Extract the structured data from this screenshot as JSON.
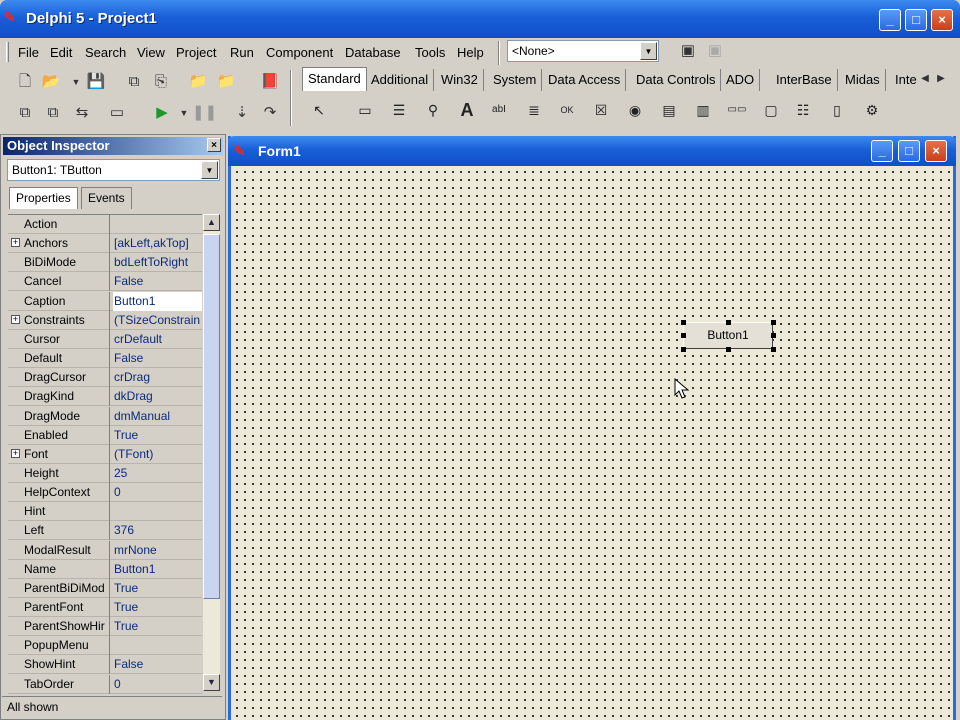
{
  "window": {
    "title": "Delphi 5 - Project1",
    "minimize": "_",
    "maximize": "□",
    "close": "×"
  },
  "menu": [
    "File",
    "Edit",
    "Search",
    "View",
    "Project",
    "Run",
    "Component",
    "Database",
    "Tools",
    "Help"
  ],
  "desktop_combo": {
    "value": "<None>"
  },
  "palette": {
    "tabs": [
      "Standard",
      "Additional",
      "Win32",
      "System",
      "Data Access",
      "Data Controls",
      "ADO",
      "InterBase",
      "Midas",
      "Inte"
    ],
    "scroll_left": "◀",
    "scroll_right": "▶",
    "components": [
      "pointer",
      "frames",
      "main-menu",
      "popup-menu",
      "label",
      "edit",
      "memo",
      "button",
      "checkbox",
      "radio-button",
      "listbox",
      "combobox",
      "scrollbar",
      "groupbox",
      "radiogroup",
      "panel",
      "actionlist"
    ]
  },
  "inspector": {
    "title": "Object Inspector",
    "close": "×",
    "object_combo": "Button1: TButton",
    "tabs": [
      "Properties",
      "Events"
    ],
    "properties": [
      {
        "name": "Action",
        "value": "",
        "expandable": false
      },
      {
        "name": "Anchors",
        "value": "[akLeft,akTop]",
        "expandable": true
      },
      {
        "name": "BiDiMode",
        "value": "bdLeftToRight",
        "expandable": false
      },
      {
        "name": "Cancel",
        "value": "False",
        "expandable": false
      },
      {
        "name": "Caption",
        "value": "Button1",
        "expandable": false,
        "selected": true
      },
      {
        "name": "Constraints",
        "value": "(TSizeConstrain",
        "expandable": true
      },
      {
        "name": "Cursor",
        "value": "crDefault",
        "expandable": false
      },
      {
        "name": "Default",
        "value": "False",
        "expandable": false
      },
      {
        "name": "DragCursor",
        "value": "crDrag",
        "expandable": false
      },
      {
        "name": "DragKind",
        "value": "dkDrag",
        "expandable": false
      },
      {
        "name": "DragMode",
        "value": "dmManual",
        "expandable": false
      },
      {
        "name": "Enabled",
        "value": "True",
        "expandable": false
      },
      {
        "name": "Font",
        "value": "(TFont)",
        "expandable": true
      },
      {
        "name": "Height",
        "value": "25",
        "expandable": false
      },
      {
        "name": "HelpContext",
        "value": "0",
        "expandable": false
      },
      {
        "name": "Hint",
        "value": "",
        "expandable": false
      },
      {
        "name": "Left",
        "value": "376",
        "expandable": false
      },
      {
        "name": "ModalResult",
        "value": "mrNone",
        "expandable": false
      },
      {
        "name": "Name",
        "value": "Button1",
        "expandable": false
      },
      {
        "name": "ParentBiDiMod",
        "value": "True",
        "expandable": false
      },
      {
        "name": "ParentFont",
        "value": "True",
        "expandable": false
      },
      {
        "name": "ParentShowHir",
        "value": "True",
        "expandable": false
      },
      {
        "name": "PopupMenu",
        "value": "",
        "expandable": false
      },
      {
        "name": "ShowHint",
        "value": "False",
        "expandable": false
      },
      {
        "name": "TabOrder",
        "value": "0",
        "expandable": false
      }
    ],
    "status": "All shown"
  },
  "form": {
    "title": "Form1",
    "minimize": "_",
    "maximize": "□",
    "close": "×",
    "button_caption": "Button1"
  }
}
